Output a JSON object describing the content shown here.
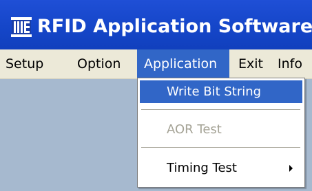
{
  "window": {
    "title": "RFID Application Software",
    "icon": "rfid-app-icon",
    "title_color": "#ffffff",
    "titlebar_color": "#1546c9"
  },
  "menubar": {
    "items": [
      {
        "label": "Setup"
      },
      {
        "label": "Option"
      },
      {
        "label": "Application",
        "active": true
      },
      {
        "label": "Exit"
      },
      {
        "label": "Info"
      }
    ],
    "active_color": "#3166c7"
  },
  "application_menu": {
    "items": [
      {
        "label": "Write Bit String",
        "state": "highlighted"
      },
      {
        "label": "AOR Test",
        "state": "disabled"
      },
      {
        "label": "Timing Test",
        "state": "enabled",
        "submenu_icon": "submenu-arrow-icon"
      }
    ]
  }
}
